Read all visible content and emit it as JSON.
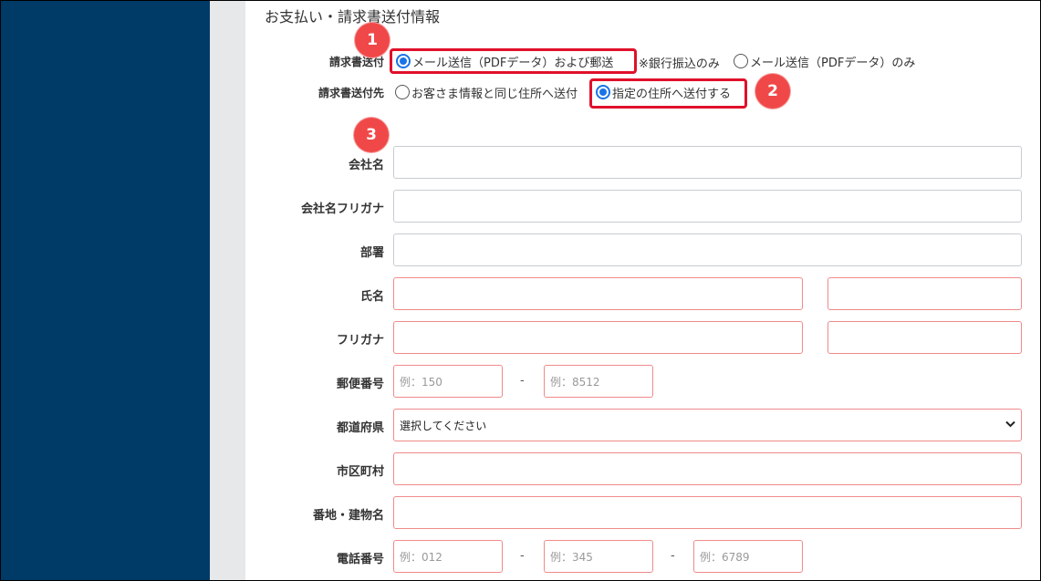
{
  "section_title": "お支払い・請求書送付情報",
  "invoice_send": {
    "label": "請求書送付",
    "options": [
      {
        "label": "メール送信（PDFデータ）および郵送",
        "checked": true
      },
      {
        "label": "メール送信（PDFデータ）のみ",
        "checked": false
      }
    ],
    "note": "※銀行振込のみ"
  },
  "invoice_destination": {
    "label": "請求書送付先",
    "options": [
      {
        "label": "お客さま情報と同じ住所へ送付",
        "checked": false
      },
      {
        "label": "指定の住所へ送付する",
        "checked": true
      }
    ]
  },
  "badges": [
    "1",
    "2",
    "3"
  ],
  "fields": {
    "company": {
      "label": "会社名"
    },
    "company_kana": {
      "label": "会社名フリガナ"
    },
    "department": {
      "label": "部署"
    },
    "name": {
      "label": "氏名"
    },
    "name_kana": {
      "label": "フリガナ"
    },
    "postal": {
      "label": "郵便番号",
      "placeholder1": "例：150",
      "placeholder2": "例：8512"
    },
    "prefecture": {
      "label": "都道府県",
      "selected": "選択してください"
    },
    "city": {
      "label": "市区町村"
    },
    "address": {
      "label": "番地・建物名"
    },
    "phone": {
      "label": "電話番号",
      "placeholder1": "例：012",
      "placeholder2": "例：345",
      "placeholder3": "例：6789"
    }
  },
  "separator": "-",
  "colors": {
    "sidebar": "#003a66",
    "highlight": "#e0102b",
    "badge": "#f04848",
    "radio_checked": "#1a73e8"
  }
}
